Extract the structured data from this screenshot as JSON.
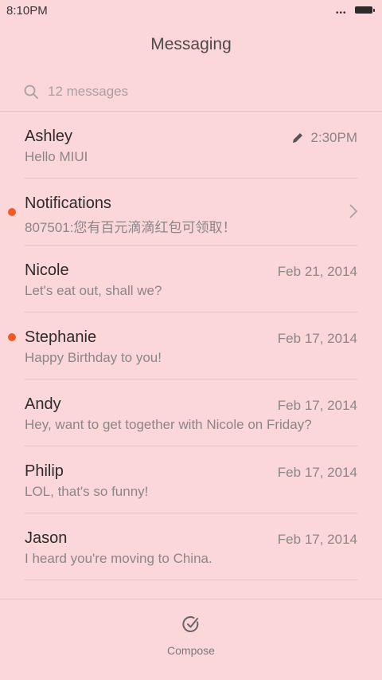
{
  "status_bar": {
    "time": "8:10PM",
    "dots": "•••",
    "battery_icon": "battery-icon"
  },
  "header": {
    "title": "Messaging"
  },
  "search": {
    "placeholder": "12 messages",
    "icon": "search-icon"
  },
  "conversations": [
    {
      "name": "Ashley",
      "preview": "Hello MIUI",
      "date": "2:30PM",
      "draft": true,
      "unread": false
    },
    {
      "name": "Notifications",
      "preview": "807501:您有百元滴滴红包可领取！",
      "date": "",
      "chevron": true,
      "unread": true
    },
    {
      "name": "Nicole",
      "preview": "Let's eat out, shall we?",
      "date": "Feb 21, 2014",
      "unread": false
    },
    {
      "name": "Stephanie",
      "preview": "Happy Birthday to you!",
      "date": "Feb 17, 2014",
      "unread": true
    },
    {
      "name": "Andy",
      "preview": "Hey, want to get together with Nicole on Friday?",
      "date": "Feb 17, 2014",
      "unread": false
    },
    {
      "name": "Philip",
      "preview": "LOL, that's so funny!",
      "date": "Feb 17, 2014",
      "unread": false
    },
    {
      "name": "Jason",
      "preview": "I heard you're moving to China.",
      "date": "Feb 17, 2014",
      "unread": false
    }
  ],
  "compose": {
    "label": "Compose",
    "icon": "compose-icon"
  },
  "colors": {
    "background": "#fbd7da",
    "unread_dot": "#f25a22",
    "divider": "#e8c2c5"
  }
}
